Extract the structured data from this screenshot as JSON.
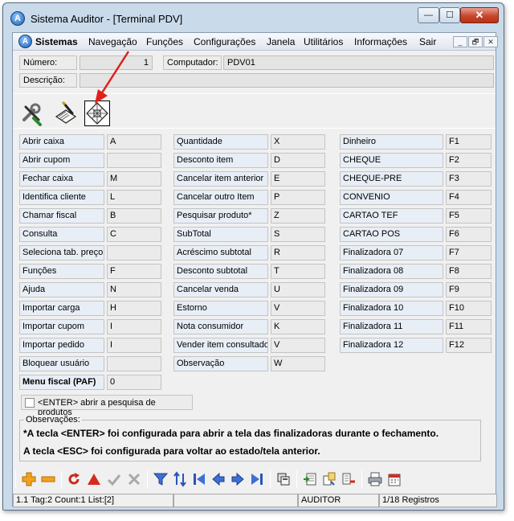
{
  "window": {
    "title": "Sistema Auditor - [Terminal PDV]",
    "app_icon_letter": "A",
    "controls": {
      "minimize": "—",
      "maximize": "☐",
      "close": "✕"
    }
  },
  "menubar": {
    "icon_letter": "A",
    "items": [
      "Sistemas",
      "Navegação",
      "Funções",
      "Configurações",
      "Janela",
      "Utilitários",
      "Informações",
      "Sair"
    ],
    "mdi_controls": [
      "_",
      "🗗",
      "✕"
    ]
  },
  "form": {
    "numero_label": "Número:",
    "numero_value": "1",
    "computador_label": "Computador:",
    "computador_value": "PDV01",
    "descricao_label": "Descrição:",
    "descricao_value": ""
  },
  "toolbar": {
    "buttons": [
      "tools-icon",
      "notepad-pen-icon",
      "keyboard-grid-icon"
    ],
    "active_index": 2,
    "annotation_arrow_color": "#e0201b"
  },
  "shortcuts": {
    "col1": [
      {
        "label": "Abrir caixa",
        "key": "A"
      },
      {
        "label": "Abrir cupom",
        "key": ""
      },
      {
        "label": "Fechar caixa",
        "key": "M"
      },
      {
        "label": "Identifica cliente",
        "key": "L"
      },
      {
        "label": "Chamar fiscal",
        "key": "B"
      },
      {
        "label": "Consulta",
        "key": "C"
      },
      {
        "label": "Seleciona tab. preço",
        "key": ""
      },
      {
        "label": "Funções",
        "key": "F"
      },
      {
        "label": "Ajuda",
        "key": "N"
      },
      {
        "label": "Importar carga",
        "key": "H"
      },
      {
        "label": "Importar cupom",
        "key": "I"
      },
      {
        "label": "Importar pedido",
        "key": "I"
      },
      {
        "label": "Bloquear usuário",
        "key": ""
      },
      {
        "label": "Menu fiscal (PAF)",
        "key": "0"
      }
    ],
    "col2": [
      {
        "label": "Quantidade",
        "key": "X"
      },
      {
        "label": "Desconto item",
        "key": "D"
      },
      {
        "label": "Cancelar item anterior",
        "key": "E"
      },
      {
        "label": "Cancelar outro Item",
        "key": "P"
      },
      {
        "label": "Pesquisar produto*",
        "key": "Z"
      },
      {
        "label": "SubTotal",
        "key": "S"
      },
      {
        "label": "Acréscimo subtotal",
        "key": "R"
      },
      {
        "label": "Desconto subtotal",
        "key": "T"
      },
      {
        "label": "Cancelar venda",
        "key": "U"
      },
      {
        "label": "Estorno",
        "key": "V"
      },
      {
        "label": "Nota consumidor",
        "key": "K"
      },
      {
        "label": "Vender item consultado",
        "key": "V"
      },
      {
        "label": "Observação",
        "key": "W"
      }
    ],
    "col3": [
      {
        "label": "Dinheiro",
        "key": "F1"
      },
      {
        "label": "CHEQUE",
        "key": "F2"
      },
      {
        "label": "CHEQUE-PRE",
        "key": "F3"
      },
      {
        "label": "CONVENIO",
        "key": "F4"
      },
      {
        "label": "CARTAO TEF",
        "key": "F5"
      },
      {
        "label": "CARTAO POS",
        "key": "F6"
      },
      {
        "label": "Finalizadora 07",
        "key": "F7"
      },
      {
        "label": "Finalizadora 08",
        "key": "F8"
      },
      {
        "label": "Finalizadora 09",
        "key": "F9"
      },
      {
        "label": "Finalizadora 10",
        "key": "F10"
      },
      {
        "label": "Finalizadora 11",
        "key": "F11"
      },
      {
        "label": "Finalizadora 12",
        "key": "F12"
      }
    ]
  },
  "enter_checkbox": {
    "label": "<ENTER> abrir a pesquisa de produtos",
    "checked": false
  },
  "observacoes": {
    "title": "Observações:",
    "line1": "*A tecla <ENTER> foi configurada para abrir a tela das finalizadoras durante o fechamento.",
    "line2": "A tecla <ESC> foi configurada para voltar ao estado/tela anterior."
  },
  "bottom_toolbar": {
    "icons": [
      "add-icon",
      "remove-icon",
      "refresh-icon",
      "warning-icon",
      "confirm-icon",
      "cancel-icon",
      "filter-icon",
      "sort-icon",
      "first-record-icon",
      "previous-record-icon",
      "next-record-icon",
      "last-record-icon",
      "copy-icon",
      "export-icon",
      "import-icon",
      "delete-list-icon",
      "print-icon",
      "calendar-icon"
    ]
  },
  "statusbar": {
    "info": "1.1 Tag:2 Count:1 List:[2]",
    "empty": "",
    "user": "AUDITOR",
    "records": "1/18 Registros"
  }
}
